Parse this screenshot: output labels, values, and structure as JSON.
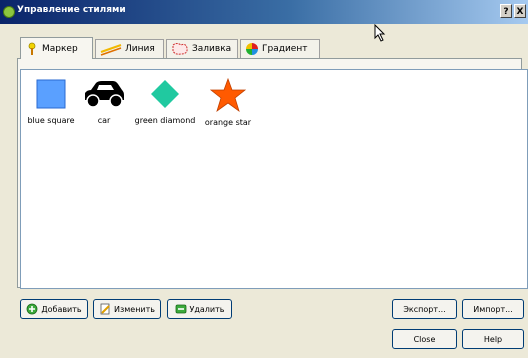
{
  "window": {
    "title": "Управление стилями",
    "help_label": "?",
    "close_label": "X"
  },
  "tabs": [
    {
      "label": "Маркер",
      "icon": "marker-icon"
    },
    {
      "label": "Линия",
      "icon": "line-icon"
    },
    {
      "label": "Заливка",
      "icon": "fill-icon"
    },
    {
      "label": "Градиент",
      "icon": "gradient-icon"
    }
  ],
  "symbols": [
    {
      "label": "blue square",
      "color": "#5aa0ff"
    },
    {
      "label": "car",
      "color": "#000000"
    },
    {
      "label": "green diamond",
      "color": "#20c9a0"
    },
    {
      "label": "orange star",
      "color": "#ff5a00"
    }
  ],
  "buttons": {
    "add": "Добавить",
    "edit": "Изменить",
    "remove": "Удалить",
    "export": "Экспорт...",
    "import": "Импорт...",
    "close": "Close",
    "help": "Help"
  }
}
